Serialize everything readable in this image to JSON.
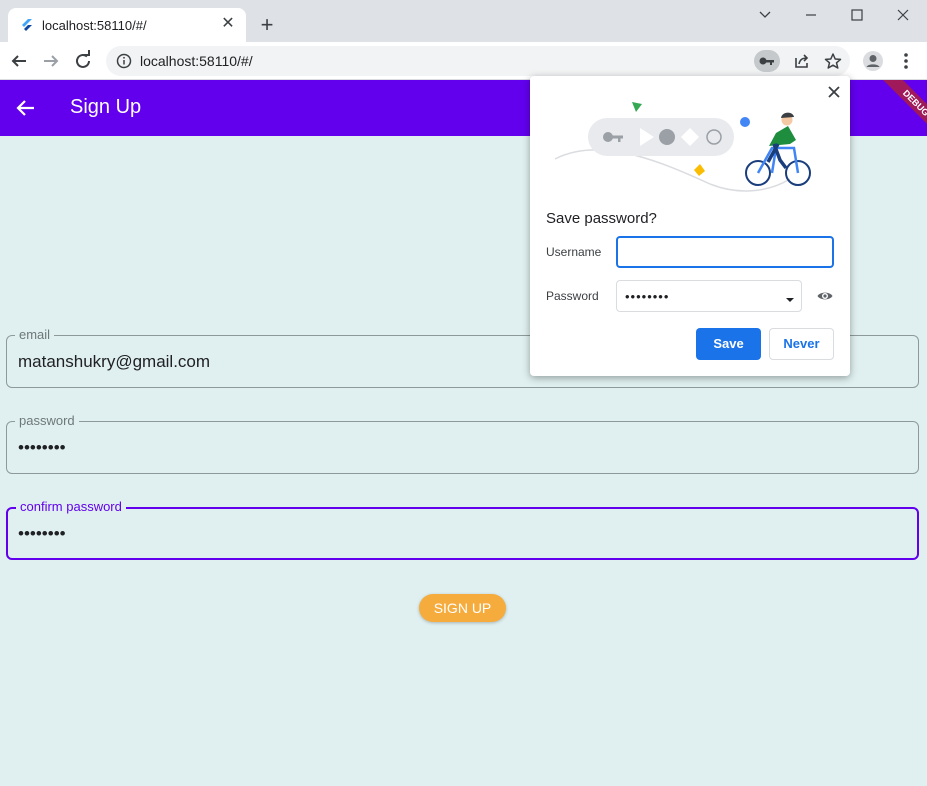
{
  "browser": {
    "tab_title": "localhost:58110/#/",
    "url": "localhost:58110/#/"
  },
  "app": {
    "title": "Sign Up",
    "debug_label": "DEBUG",
    "accent_color": "#6200ee"
  },
  "form": {
    "email": {
      "label": "email",
      "value": "matanshukry@gmail.com"
    },
    "password": {
      "label": "password",
      "value": "••••••••"
    },
    "confirm": {
      "label": "confirm password",
      "value": "••••••••"
    },
    "submit_label": "SIGN UP"
  },
  "popup": {
    "title": "Save password?",
    "username_label": "Username",
    "username_value": "",
    "password_label": "Password",
    "password_value": "••••••••",
    "save_label": "Save",
    "never_label": "Never"
  },
  "icons": {
    "favicon": "flutter-icon",
    "back": "arrow-left-icon",
    "forward": "arrow-right-icon",
    "reload": "reload-icon",
    "site_info": "info-icon",
    "key": "key-icon",
    "share": "share-icon",
    "bookmark": "star-icon",
    "profile": "avatar-icon",
    "menu": "kebab-menu-icon",
    "eye": "eye-icon"
  }
}
